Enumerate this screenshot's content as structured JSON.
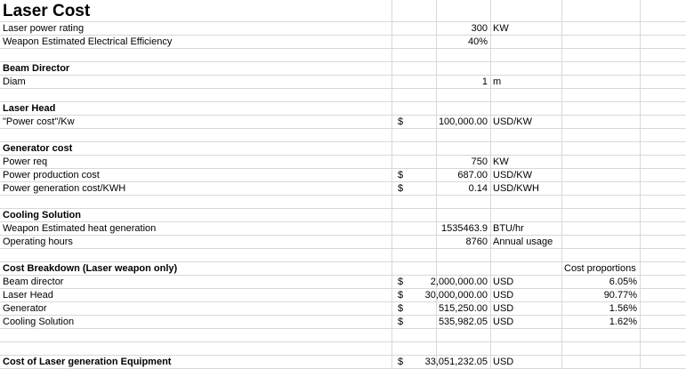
{
  "title": "Laser Cost",
  "rows": [
    {
      "a": "Laser power rating",
      "c": "300",
      "d": "KW"
    },
    {
      "a": "Weapon Estimated Electrical Efficiency",
      "c": "40%"
    },
    {
      "a": ""
    },
    {
      "a": "Beam Director",
      "bold": true
    },
    {
      "a": "Diam",
      "c": "1",
      "d": "m"
    },
    {
      "a": ""
    },
    {
      "a": "Laser Head",
      "bold": true
    },
    {
      "a": "\"Power cost\"/Kw",
      "b": "$",
      "c": "100,000.00",
      "d": "USD/KW"
    },
    {
      "a": ""
    },
    {
      "a": "Generator cost",
      "bold": true
    },
    {
      "a": "Power req",
      "c": "750",
      "d": "KW"
    },
    {
      "a": "Power production cost",
      "b": "$",
      "c": "687.00",
      "d": "USD/KW"
    },
    {
      "a": "Power generation cost/KWH",
      "b": "$",
      "c": "0.14",
      "d": "USD/KWH"
    },
    {
      "a": ""
    },
    {
      "a": "Cooling Solution",
      "bold": true
    },
    {
      "a": "Weapon Estimated heat generation",
      "c": "1535463.9",
      "d": "BTU/hr"
    },
    {
      "a": "Operating hours",
      "c": "8760",
      "d": "Annual usage"
    },
    {
      "a": ""
    },
    {
      "a": "Cost Breakdown (Laser weapon only)",
      "bold": true,
      "e": "Cost proportions"
    },
    {
      "a": "Beam director",
      "b": "$",
      "c": "2,000,000.00",
      "d": "USD",
      "f": "6.05%"
    },
    {
      "a": "Laser Head",
      "b": "$",
      "c": "30,000,000.00",
      "d": "USD",
      "f": "90.77%"
    },
    {
      "a": "Generator",
      "b": "$",
      "c": "515,250.00",
      "d": "USD",
      "f": "1.56%"
    },
    {
      "a": "Cooling Solution",
      "b": "$",
      "c": "535,982.05",
      "d": "USD",
      "f": "1.62%"
    },
    {
      "a": ""
    },
    {
      "a": ""
    },
    {
      "a": "Cost of Laser generation Equipment",
      "bold": true,
      "b": "$",
      "c": "33,051,232.05",
      "d": "USD"
    }
  ]
}
